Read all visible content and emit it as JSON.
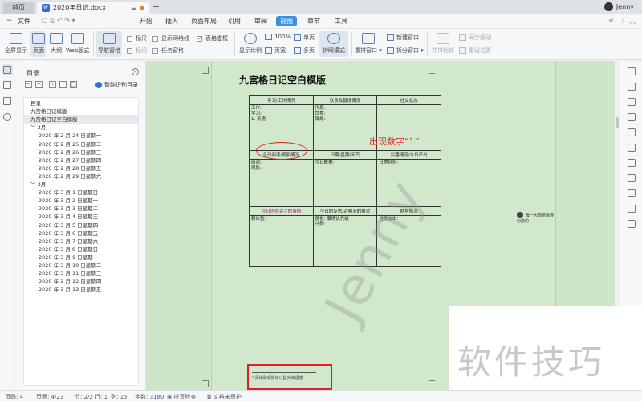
{
  "titlebar": {
    "home_tab": "首页",
    "doc_tab": "2020年日记.docx",
    "doc_badge": "W",
    "new_tab": "+",
    "user": "Jenny"
  },
  "menubar": {
    "file": "文件",
    "items": [
      "开始",
      "插入",
      "页面布局",
      "引用",
      "审阅",
      "视图",
      "章节",
      "工具"
    ],
    "active": "视图"
  },
  "ribbon": {
    "fullscreen": "全屏显示",
    "page_view": "页面",
    "outline": "大纲",
    "web_view": "Web版式",
    "nav_pane": "导航窗格",
    "ruler": "标尺",
    "show_grid": "显示网格线",
    "table_dashed": "表格虚框",
    "markup": "标记",
    "task_pane": "任务窗格",
    "zoom": "显示比例",
    "zoom_100": "100%",
    "single_page": "单页",
    "page_width": "页宽",
    "multi_page": "多页",
    "eye_mode": "护眼模式",
    "rearrange": "重排窗口",
    "new_window": "新建窗口",
    "split_window": "拆分窗口",
    "side_by_side": "并排比较",
    "sync_scroll": "同步滚动",
    "reset_pos": "重设位置"
  },
  "nav": {
    "title": "目录",
    "smart_toc": "智能识别目录",
    "items": [
      {
        "text": "目录",
        "indent": 0
      },
      {
        "text": "九宫格日记模版",
        "indent": 0
      },
      {
        "text": "九宫格日记空白模版",
        "indent": 0,
        "selected": true
      },
      {
        "text": "﹀ 2月",
        "indent": 0
      },
      {
        "text": "2020 年 2 月 24 日星期一",
        "indent": 1
      },
      {
        "text": "2020 年 2 月 25 日星期二",
        "indent": 1
      },
      {
        "text": "2020 年 2 月 26 日星期三",
        "indent": 1
      },
      {
        "text": "2020 年 2 月 27 日星期四",
        "indent": 1
      },
      {
        "text": "2020 年 2 月 28 日星期五",
        "indent": 1
      },
      {
        "text": "2020 年 2 月 29 日星期六",
        "indent": 1
      },
      {
        "text": "﹀ 3月",
        "indent": 0
      },
      {
        "text": "2020 年 3 月 1 日星期日",
        "indent": 1
      },
      {
        "text": "2020 年 3 月 2 日星期一",
        "indent": 1
      },
      {
        "text": "2020 年 3 月 3 日星期二",
        "indent": 1
      },
      {
        "text": "2020 年 3 月 4 日星期三",
        "indent": 1
      },
      {
        "text": "2020 年 3 月 5 日星期四",
        "indent": 1
      },
      {
        "text": "2020 年 3 月 6 日星期五",
        "indent": 1
      },
      {
        "text": "2020 年 3 月 7 日星期六",
        "indent": 1
      },
      {
        "text": "2020 年 3 月 8 日星期日",
        "indent": 1
      },
      {
        "text": "2020 年 3 月 9 日星期一",
        "indent": 1
      },
      {
        "text": "2020 年 3 月 10 日星期二",
        "indent": 1
      },
      {
        "text": "2020 年 3 月 11 日星期三",
        "indent": 1
      },
      {
        "text": "2020 年 3 月 12 日星期四",
        "indent": 1
      },
      {
        "text": "2020 年 3 月 13 日星期五",
        "indent": 1
      }
    ]
  },
  "document": {
    "title": "九宫格日记空白模版",
    "rows": [
      [
        {
          "header": "学习/工作情况",
          "body": [
            "工作:",
            "学习:",
            "1. 英语"
          ]
        },
        {
          "header": "饮食及锻炼情况",
          "body": [
            "作息:",
            "饮食:",
            "锻炼:"
          ]
        },
        {
          "header": "社交状态",
          "body": []
        }
      ],
      [
        {
          "header": "今日阅读/观影情况",
          "body": [
            "阅读:",
            "观影:"
          ]
        },
        {
          "header": "日期/星期/天气",
          "body": [
            "今日概要:"
          ]
        },
        {
          "header": "兴趣情况/今日产出",
          "body": [
            "日常经验:"
          ]
        }
      ],
      [
        {
          "header": "今日值得关注的事情",
          "body": [
            "新体验:"
          ],
          "pink": true
        },
        {
          "header": "今日的反思/对明天的展望",
          "body": [
            "反省: 事情优先级",
            "计划:"
          ]
        },
        {
          "header": "财务情况",
          "body": [
            "当天支出:"
          ]
        }
      ]
    ],
    "annotation": "出现数字“1”",
    "watermark": "Jenny",
    "footnote": "¹ 阅读和观影可以提升幸福感",
    "comment": "每一天都是值得纪念的"
  },
  "corner_watermark": "软件技巧",
  "statusbar": {
    "page": "页码: 4",
    "pages": "页面: 4/23",
    "section": "节: 2/2",
    "row": "行: 1",
    "col": "列: 15",
    "words": "字数: 3180",
    "spellcheck": "拼写检查",
    "protect": "文档未保护"
  }
}
